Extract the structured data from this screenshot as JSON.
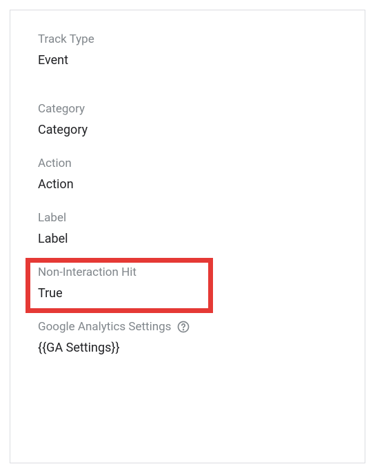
{
  "fields": {
    "track_type": {
      "label": "Track Type",
      "value": "Event"
    },
    "category": {
      "label": "Category",
      "value": "Category"
    },
    "action": {
      "label": "Action",
      "value": "Action"
    },
    "label": {
      "label": "Label",
      "value": "Label"
    },
    "non_interaction": {
      "label": "Non-Interaction Hit",
      "value": "True"
    },
    "ga_settings": {
      "label": "Google Analytics Settings",
      "value": "{{GA Settings}}"
    }
  }
}
